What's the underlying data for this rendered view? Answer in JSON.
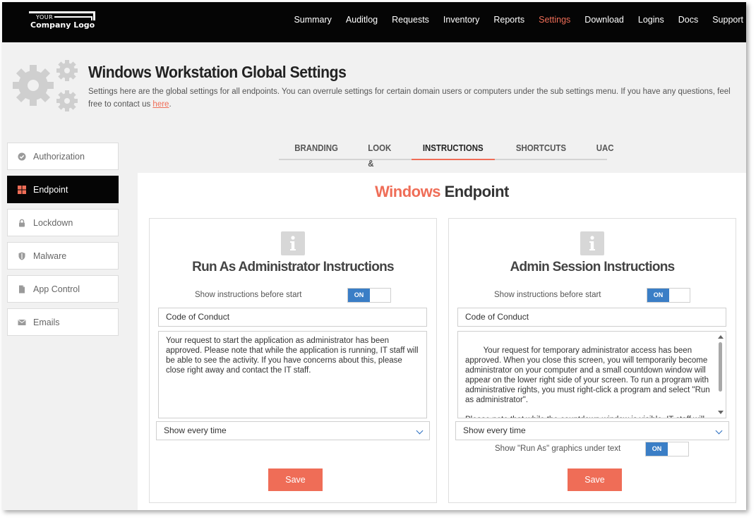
{
  "logo": {
    "small": "YOUR",
    "big": "Company Logo"
  },
  "nav": [
    {
      "label": "Summary",
      "active": false
    },
    {
      "label": "Auditlog",
      "active": false
    },
    {
      "label": "Requests",
      "active": false
    },
    {
      "label": "Inventory",
      "active": false
    },
    {
      "label": "Reports",
      "active": false
    },
    {
      "label": "Settings",
      "active": true
    },
    {
      "label": "Download",
      "active": false
    },
    {
      "label": "Logins",
      "active": false
    },
    {
      "label": "Docs",
      "active": false
    },
    {
      "label": "Support",
      "active": false
    }
  ],
  "header": {
    "title": "Windows Workstation Global Settings",
    "description": "Settings here are the global settings for all endpoints. You can overrule settings for certain domain users or computers under the sub settings menu. If you have any questions, feel free to contact us ",
    "link_text": "here",
    "suffix": "."
  },
  "sidebar": [
    {
      "label": "Authorization",
      "icon": "check-circle-icon"
    },
    {
      "label": "Endpoint",
      "icon": "windows-icon"
    },
    {
      "label": "Lockdown",
      "icon": "lock-icon"
    },
    {
      "label": "Malware",
      "icon": "shield-icon"
    },
    {
      "label": "App Control",
      "icon": "file-icon"
    },
    {
      "label": "Emails",
      "icon": "envelope-icon"
    }
  ],
  "tabs": [
    {
      "label": "BRANDING"
    },
    {
      "label": "LOOK & FEEL"
    },
    {
      "label": "INSTRUCTIONS"
    },
    {
      "label": "SHORTCUTS"
    },
    {
      "label": "UAC"
    }
  ],
  "main": {
    "title_accent": "Windows",
    "title_rest": " Endpoint"
  },
  "cards": {
    "left": {
      "title": "Run As Administrator Instructions",
      "show_label": "Show instructions before start",
      "toggle": "ON",
      "input_value": "Code of Conduct",
      "text": "Your request to start the application as administrator has been approved. Please note that while the application is running, IT staff will be able to see the activity. If you have concerns about this, please close right away and contact the IT staff.",
      "select_value": "Show every time",
      "save": "Save"
    },
    "right": {
      "title": "Admin Session Instructions",
      "show_label": "Show instructions before start",
      "toggle": "ON",
      "input_value": "Code of Conduct",
      "text": "Your request for temporary administrator access has been approved. When you close this screen, you will temporarily become administrator on your computer and a small countdown window will appear on the lower right side of your screen. To run a program with administrative rights, you must right-click a program and select \"Run as administrator\".\n\nPlease note that while the countdown window is visible, IT staff will be able to see, which applications you install and which",
      "select_value": "Show every time",
      "graphics_label": "Show \"Run As\" graphics under text",
      "graphics_toggle": "ON",
      "save": "Save"
    }
  },
  "colors": {
    "accent": "#ef6d57",
    "toggle_blue": "#3a7ec6",
    "topbar": "#050505"
  }
}
